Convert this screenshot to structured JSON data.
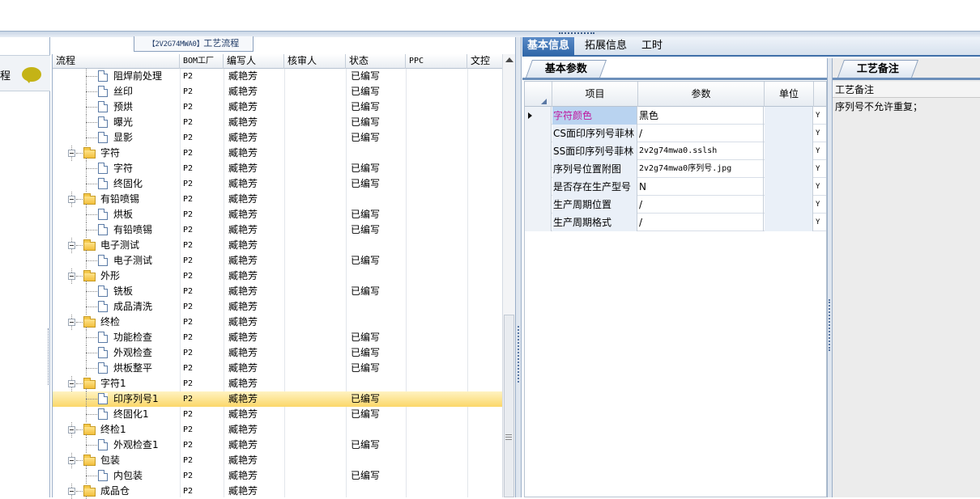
{
  "left_panel": {
    "header_text": "程"
  },
  "flow_panel": {
    "title_code": "【2V2G74MWA0】",
    "title_text": "工艺流程",
    "columns": [
      "流程",
      "BOM工厂",
      "编写人",
      "核审人",
      "状态",
      "PPC",
      "文控"
    ],
    "rows": [
      {
        "level": 2,
        "type": "doc",
        "name": "阻焊前处理",
        "bom": "P2",
        "author": "臧艳芳",
        "status": "已编写"
      },
      {
        "level": 2,
        "type": "doc",
        "name": "丝印",
        "bom": "P2",
        "author": "臧艳芳",
        "status": "已编写"
      },
      {
        "level": 2,
        "type": "doc",
        "name": "预烘",
        "bom": "P2",
        "author": "臧艳芳",
        "status": "已编写"
      },
      {
        "level": 2,
        "type": "doc",
        "name": "曝光",
        "bom": "P2",
        "author": "臧艳芳",
        "status": "已编写"
      },
      {
        "level": 2,
        "type": "doc",
        "name": "显影",
        "bom": "P2",
        "author": "臧艳芳",
        "status": "已编写"
      },
      {
        "level": 1,
        "type": "folder",
        "name": "字符",
        "bom": "P2",
        "author": "臧艳芳",
        "status": ""
      },
      {
        "level": 2,
        "type": "doc",
        "name": "字符",
        "bom": "P2",
        "author": "臧艳芳",
        "status": "已编写"
      },
      {
        "level": 2,
        "type": "doc",
        "name": "终固化",
        "bom": "P2",
        "author": "臧艳芳",
        "status": "已编写"
      },
      {
        "level": 1,
        "type": "folder",
        "name": "有铅喷锡",
        "bom": "P2",
        "author": "臧艳芳",
        "status": ""
      },
      {
        "level": 2,
        "type": "doc",
        "name": "烘板",
        "bom": "P2",
        "author": "臧艳芳",
        "status": "已编写"
      },
      {
        "level": 2,
        "type": "doc",
        "name": "有铅喷锡",
        "bom": "P2",
        "author": "臧艳芳",
        "status": "已编写"
      },
      {
        "level": 1,
        "type": "folder",
        "name": "电子测试",
        "bom": "P2",
        "author": "臧艳芳",
        "status": ""
      },
      {
        "level": 2,
        "type": "doc",
        "name": "电子测试",
        "bom": "P2",
        "author": "臧艳芳",
        "status": "已编写"
      },
      {
        "level": 1,
        "type": "folder",
        "name": "外形",
        "bom": "P2",
        "author": "臧艳芳",
        "status": ""
      },
      {
        "level": 2,
        "type": "doc",
        "name": "铣板",
        "bom": "P2",
        "author": "臧艳芳",
        "status": "已编写"
      },
      {
        "level": 2,
        "type": "doc",
        "name": "成品清洗",
        "bom": "P2",
        "author": "臧艳芳",
        "status": ""
      },
      {
        "level": 1,
        "type": "folder",
        "name": "终检",
        "bom": "P2",
        "author": "臧艳芳",
        "status": ""
      },
      {
        "level": 2,
        "type": "doc",
        "name": "功能检查",
        "bom": "P2",
        "author": "臧艳芳",
        "status": "已编写"
      },
      {
        "level": 2,
        "type": "doc",
        "name": "外观检查",
        "bom": "P2",
        "author": "臧艳芳",
        "status": "已编写"
      },
      {
        "level": 2,
        "type": "doc",
        "name": "烘板整平",
        "bom": "P2",
        "author": "臧艳芳",
        "status": "已编写"
      },
      {
        "level": 1,
        "type": "folder",
        "name": "字符1",
        "bom": "P2",
        "author": "臧艳芳",
        "status": ""
      },
      {
        "level": 2,
        "type": "doc",
        "name": "印序列号1",
        "bom": "P2",
        "author": "臧艳芳",
        "status": "已编写",
        "selected": true
      },
      {
        "level": 2,
        "type": "doc",
        "name": "终固化1",
        "bom": "P2",
        "author": "臧艳芳",
        "status": "已编写"
      },
      {
        "level": 1,
        "type": "folder",
        "name": "终检1",
        "bom": "P2",
        "author": "臧艳芳",
        "status": ""
      },
      {
        "level": 2,
        "type": "doc",
        "name": "外观检查1",
        "bom": "P2",
        "author": "臧艳芳",
        "status": "已编写"
      },
      {
        "level": 1,
        "type": "folder",
        "name": "包装",
        "bom": "P2",
        "author": "臧艳芳",
        "status": ""
      },
      {
        "level": 2,
        "type": "doc",
        "name": "内包装",
        "bom": "P2",
        "author": "臧艳芳",
        "status": "已编写"
      },
      {
        "level": 1,
        "type": "folder",
        "name": "成品仓",
        "bom": "P2",
        "author": "臧艳芳",
        "status": ""
      }
    ]
  },
  "right_tabs": [
    "基本信息",
    "拓展信息",
    "工时"
  ],
  "basic_params": {
    "tab_label": "基本参数",
    "columns": [
      "项目",
      "参数",
      "单位"
    ],
    "rows": [
      {
        "item": "字符颜色",
        "value": "黑色",
        "unit": "",
        "flag": "Y",
        "current": true
      },
      {
        "item": "CS面印序列号菲林",
        "value": "/",
        "unit": "",
        "flag": "Y"
      },
      {
        "item": "SS面印序列号菲林",
        "value": "2v2g74mwa0.sslsh",
        "unit": "",
        "flag": "Y"
      },
      {
        "item": "序列号位置附图",
        "value": "2v2g74mwa0序列号.jpg",
        "unit": "",
        "flag": "Y"
      },
      {
        "item": "是否存在生产型号",
        "value": "N",
        "unit": "",
        "flag": "Y"
      },
      {
        "item": "生产周期位置",
        "value": "/",
        "unit": "",
        "flag": "Y"
      },
      {
        "item": "生产周期格式",
        "value": "/",
        "unit": "",
        "flag": "Y"
      }
    ]
  },
  "remarks": {
    "tab_label": "工艺备注",
    "header": "工艺备注",
    "text": "序列号不允许重复；"
  },
  "colors": {
    "accent": "#2f66a8",
    "selected_row": "#fbd769",
    "highlight_text": "#c0179e"
  }
}
